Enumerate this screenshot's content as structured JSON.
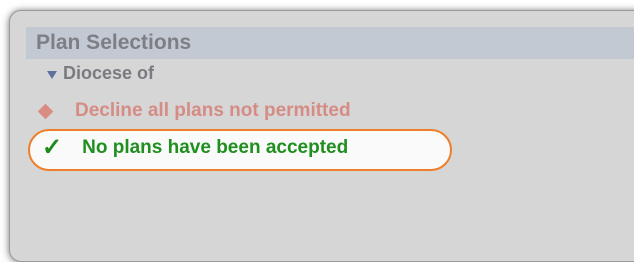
{
  "panel": {
    "title": "Plan Selections",
    "group_label": "Diocese of"
  },
  "status": {
    "decline_label": "Decline all plans not permitted",
    "decline_icon": "diamond-icon",
    "accepted_label": "No plans have been accepted",
    "accepted_icon": "check-icon",
    "accepted_check_glyph": "✓"
  },
  "colors": {
    "decline": "#d58c85",
    "accepted": "#1f8f1f",
    "highlight": "#ef7d2a"
  }
}
